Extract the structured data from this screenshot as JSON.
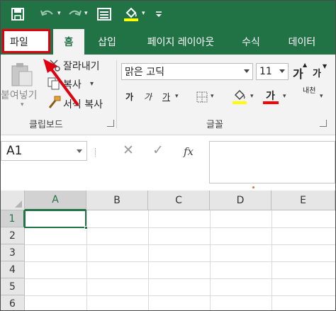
{
  "qat": {
    "save_icon": "save-icon",
    "undo_icon": "undo-icon",
    "redo_icon": "redo-icon",
    "form_icon": "form-icon",
    "fill_color_icon": "paint-bucket-icon",
    "customize_icon": "customize-qat-icon"
  },
  "tabs": [
    {
      "label": "파일"
    },
    {
      "label": "홈"
    },
    {
      "label": "삽입"
    },
    {
      "label": "페이지 레이아웃"
    },
    {
      "label": "수식"
    },
    {
      "label": "데이터"
    }
  ],
  "clipboard": {
    "paste_label": "붙여넣기",
    "cut_label": "잘라내기",
    "copy_label": "복사",
    "format_painter_label": "서식 복사",
    "group_label": "클립보드"
  },
  "font": {
    "name": "맑은 고딕",
    "size": "11",
    "grow_label": "가",
    "shrink_label": "가",
    "bold_label": "가",
    "italic_label": "가",
    "underline_label": "가",
    "font_color_label": "가",
    "phonetic_label": "내천",
    "group_label": "글꼴",
    "fill_color": "#ffff00",
    "font_color": "#ff0000"
  },
  "formula_bar": {
    "name_box": "A1",
    "cancel_glyph": "✕",
    "enter_glyph": "✓",
    "fx_label": "fx",
    "formula": ""
  },
  "grid": {
    "columns": [
      "A",
      "B",
      "C",
      "D",
      "E"
    ],
    "rows": [
      "1",
      "2",
      "3",
      "4",
      "5",
      "6"
    ],
    "active_cell": "A1"
  },
  "colors": {
    "accent": "#217346",
    "highlight_box": "#e0000f",
    "arrow": "#e0000f"
  }
}
